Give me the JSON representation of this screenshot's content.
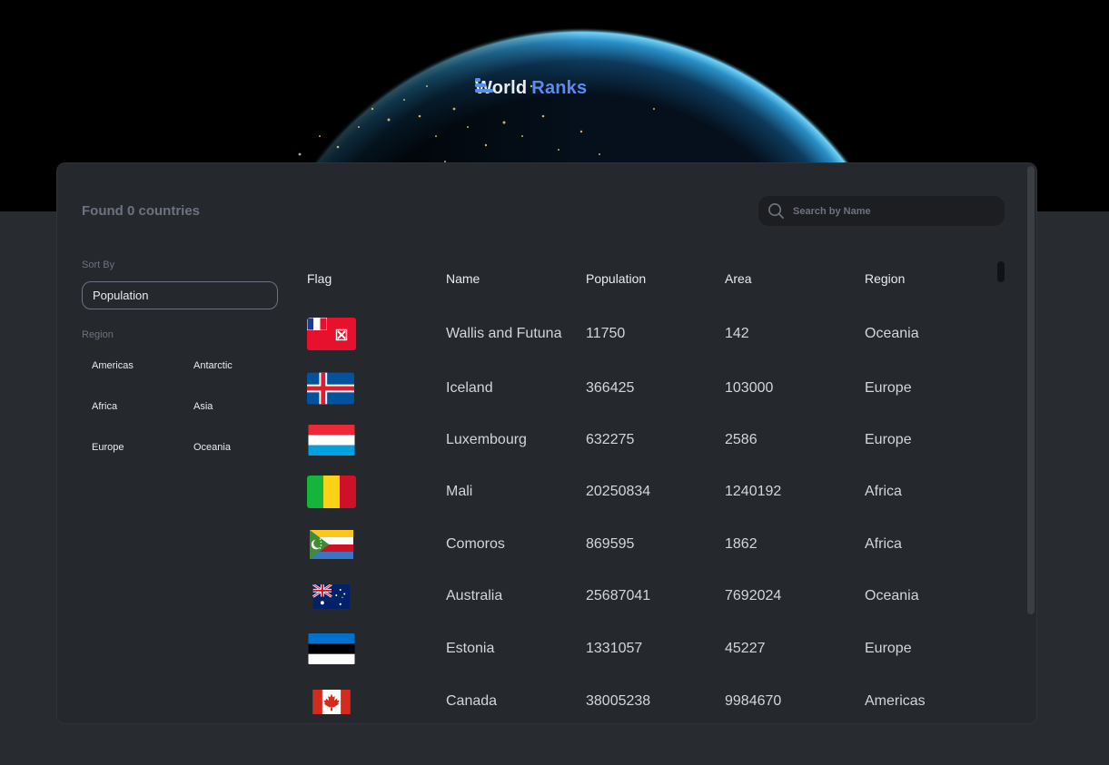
{
  "app": {
    "brand_word1": "World",
    "brand_word2": "Ranks"
  },
  "colors": {
    "accent": "#5a8cf0",
    "background": "#282b30",
    "panel": "#25282d",
    "muted": "#6c727f"
  },
  "summary": {
    "found_text": "Found 0 countries"
  },
  "search": {
    "placeholder": "Search by Name",
    "icon": "search-icon"
  },
  "sidebar": {
    "sort_label": "Sort By",
    "sort_value": "Population",
    "region_label": "Region",
    "regions": [
      "Americas",
      "Antarctic",
      "Africa",
      "Asia",
      "Europe",
      "Oceania"
    ]
  },
  "table": {
    "headers": [
      "Flag",
      "Name",
      "Population",
      "Area",
      "Region"
    ],
    "rows": [
      {
        "flag": "flag-wallis-futuna",
        "name": "Wallis and Futuna",
        "population": "11750",
        "area": "142",
        "region": "Oceania"
      },
      {
        "flag": "flag-iceland",
        "name": "Iceland",
        "population": "366425",
        "area": "103000",
        "region": "Europe"
      },
      {
        "flag": "flag-luxembourg",
        "name": "Luxembourg",
        "population": "632275",
        "area": "2586",
        "region": "Europe"
      },
      {
        "flag": "flag-mali",
        "name": "Mali",
        "population": "20250834",
        "area": "1240192",
        "region": "Africa"
      },
      {
        "flag": "flag-comoros",
        "name": "Comoros",
        "population": "869595",
        "area": "1862",
        "region": "Africa"
      },
      {
        "flag": "flag-australia",
        "name": "Australia",
        "population": "25687041",
        "area": "7692024",
        "region": "Oceania"
      },
      {
        "flag": "flag-estonia",
        "name": "Estonia",
        "population": "1331057",
        "area": "45227",
        "region": "Europe"
      },
      {
        "flag": "flag-canada",
        "name": "Canada",
        "population": "38005238",
        "area": "9984670",
        "region": "Americas"
      }
    ]
  }
}
